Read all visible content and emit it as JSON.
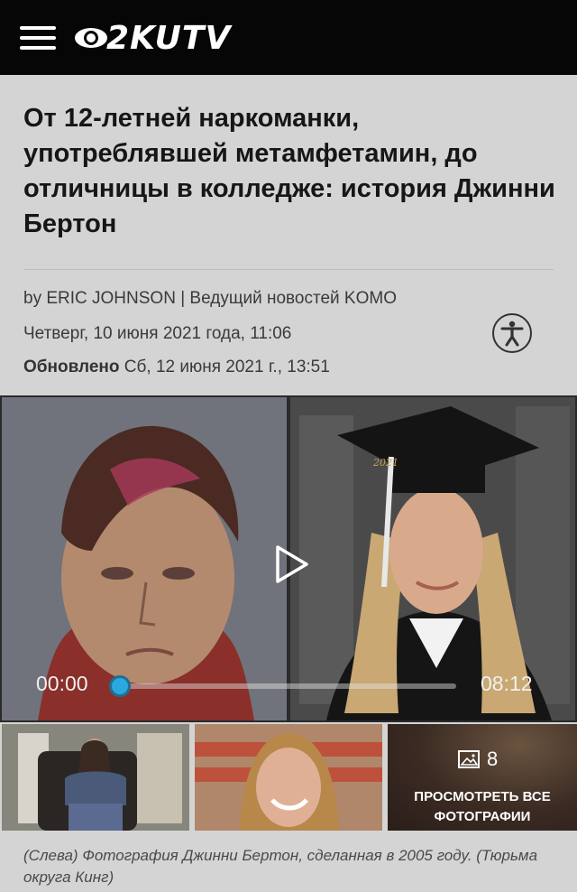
{
  "header": {
    "logo_text": "2KUTV",
    "logo_icon": "cbs-eye-icon",
    "menu_icon": "hamburger-menu-icon"
  },
  "article": {
    "headline": "От 12-летней наркоманки, употреблявшей метамфетамин, до отличницы в колледже: история Джинни Бертон",
    "byline_prefix": "by",
    "author": "ERIC JOHNSON",
    "author_role": "| Ведущий новостей KOMO",
    "published": "Четверг, 10 июня 2021 года, 11:06",
    "updated_label": "Обновлено",
    "updated_value": "Сб, 12 июня 2021 г., 13:51",
    "accessibility_icon": "accessibility-icon"
  },
  "video": {
    "current_time": "00:00",
    "duration": "08:12",
    "progress": 0.0,
    "accent_color": "#2aa9e0",
    "cap_text": "2021"
  },
  "gallery": {
    "count": "8",
    "count_icon": "image-icon",
    "label": "ПРОСМОТРЕТЬ ВСЕ ФОТОГРАФИИ"
  },
  "caption": "(Слева) Фотография Джинни Бертон, сделанная в 2005 году. (Тюрьма округа Кинг)"
}
